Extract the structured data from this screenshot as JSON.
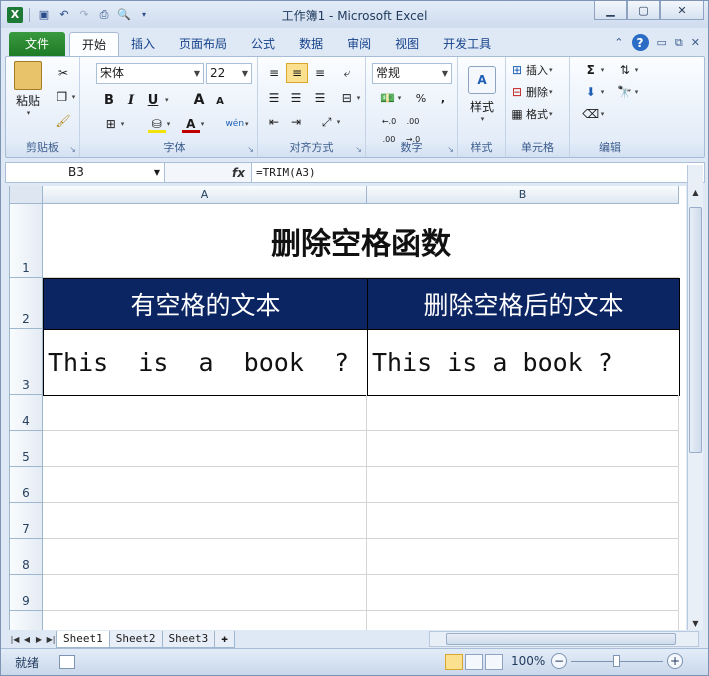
{
  "window": {
    "title": "工作簿1 - Microsoft Excel",
    "controls": {
      "minimize": "▁",
      "restore": "▢",
      "close": "✕"
    }
  },
  "ribbon_tabs": [
    "文件",
    "开始",
    "插入",
    "页面布局",
    "公式",
    "数据",
    "审阅",
    "视图",
    "开发工具"
  ],
  "ribbon": {
    "clipboard": {
      "paste": "粘贴",
      "label": "剪贴板"
    },
    "font": {
      "name": "宋体",
      "size": "22",
      "bold": "B",
      "italic": "I",
      "underline": "U",
      "grow": "A",
      "shrink": "A",
      "color": "A",
      "wen": "wén",
      "label": "字体"
    },
    "alignment": {
      "label": "对齐方式"
    },
    "number": {
      "format": "常规",
      "percent": "%",
      "comma": ",",
      "label": "数字"
    },
    "styles": {
      "label": "样式"
    },
    "cells": {
      "insert": "插入",
      "delete": "删除",
      "format": "格式",
      "label": "单元格"
    },
    "editing": {
      "sum": "Σ",
      "label": "编辑"
    }
  },
  "formula_bar": {
    "name_box": "B3",
    "fx": "fx",
    "formula": "=TRIM(A3)"
  },
  "sheet": {
    "columns": [
      "A",
      "B"
    ],
    "rows": [
      "1",
      "2",
      "3",
      "4",
      "5",
      "6",
      "7",
      "8",
      "9"
    ],
    "title": "删除空格函数",
    "header_a": "有空格的文本",
    "header_b": "删除空格后的文本",
    "a3": "This  is  a  book  ?",
    "b3": "This is a book ?"
  },
  "sheet_tabs": [
    "Sheet1",
    "Sheet2",
    "Sheet3"
  ],
  "status": {
    "ready": "就绪",
    "zoom": "100%",
    "zoom_minus": "−",
    "zoom_plus": "+"
  },
  "colors": {
    "header_fill": "#0b2462",
    "file_tab": "#2a8a31",
    "active_view": "#fbe18f"
  }
}
